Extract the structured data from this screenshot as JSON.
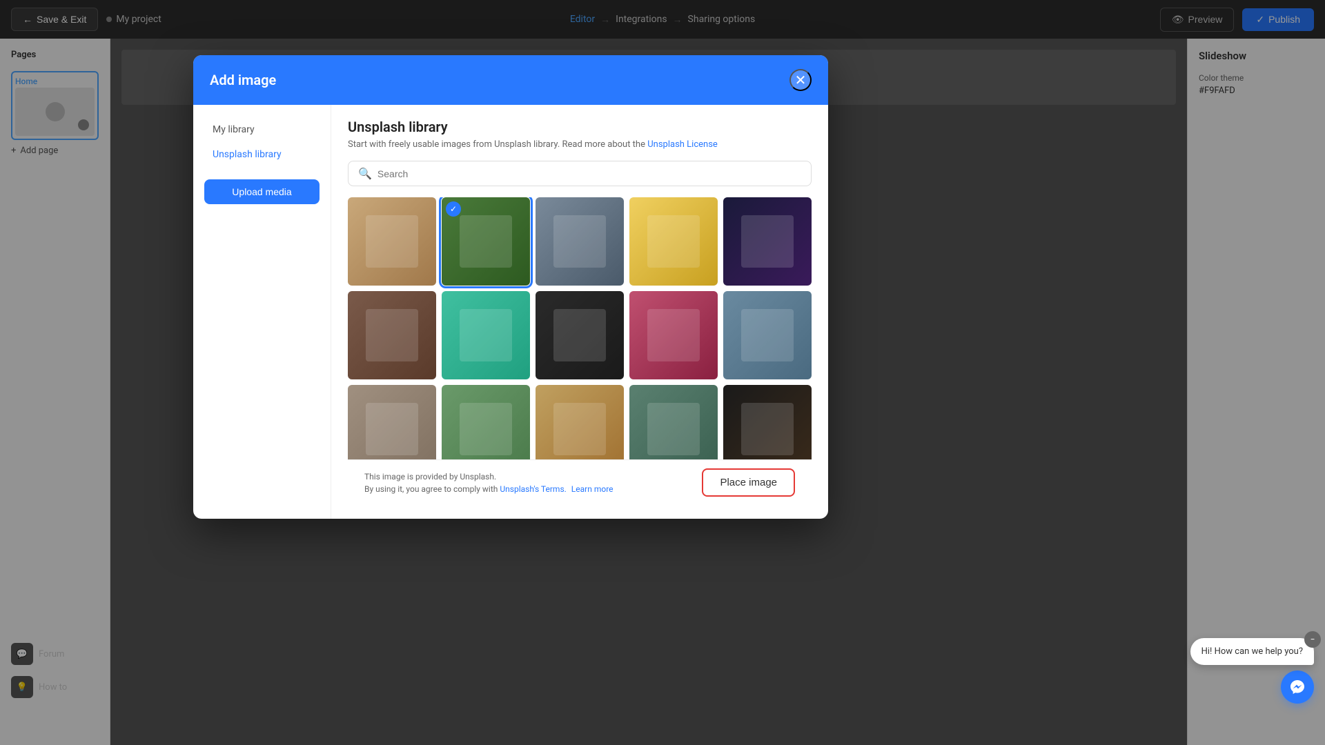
{
  "topNav": {
    "saveExit": "Save & Exit",
    "projectName": "My project",
    "steps": [
      {
        "label": "Editor",
        "active": true
      },
      {
        "label": "Integrations",
        "active": false
      },
      {
        "label": "Sharing options",
        "active": false
      }
    ],
    "preview": "Preview",
    "publish": "Publish"
  },
  "leftSidebar": {
    "title": "Pages",
    "pages": [
      {
        "label": "Home",
        "selected": true
      }
    ],
    "addPage": "Add page",
    "bottomItems": [
      {
        "label": "Forum",
        "icon": "💬"
      },
      {
        "label": "How to",
        "icon": "💡"
      }
    ]
  },
  "rightSidebar": {
    "title": "Slideshow",
    "colorThemeLabel": "Color theme",
    "colorThemeValue": "#F9FAFD"
  },
  "modal": {
    "title": "Add image",
    "closeLabel": "×",
    "sidebar": {
      "items": [
        {
          "label": "My library",
          "active": false
        },
        {
          "label": "Unsplash library",
          "active": true
        }
      ],
      "uploadBtn": "Upload media"
    },
    "content": {
      "title": "Unsplash library",
      "description": "Start with freely usable images from Unsplash library. Read more about the",
      "linkText": "Unsplash License",
      "search": {
        "placeholder": "Search",
        "value": ""
      },
      "images": [
        {
          "id": 1,
          "selected": false,
          "class": "img-1"
        },
        {
          "id": 2,
          "selected": true,
          "class": "img-2"
        },
        {
          "id": 3,
          "selected": false,
          "class": "img-3"
        },
        {
          "id": 4,
          "selected": false,
          "class": "img-4"
        },
        {
          "id": 5,
          "selected": false,
          "class": "img-5"
        },
        {
          "id": 6,
          "selected": false,
          "class": "img-6"
        },
        {
          "id": 7,
          "selected": false,
          "class": "img-7"
        },
        {
          "id": 8,
          "selected": false,
          "class": "img-8"
        },
        {
          "id": 9,
          "selected": false,
          "class": "img-9"
        },
        {
          "id": 10,
          "selected": false,
          "class": "img-10"
        },
        {
          "id": 11,
          "selected": false,
          "class": "img-11"
        },
        {
          "id": 12,
          "selected": false,
          "class": "img-12"
        },
        {
          "id": 13,
          "selected": false,
          "class": "img-13"
        },
        {
          "id": 14,
          "selected": false,
          "class": "img-14"
        },
        {
          "id": 15,
          "selected": false,
          "class": "img-15"
        }
      ]
    },
    "footer": {
      "line1": "This image is provided by Unsplash.",
      "line2": "By using it, you agree to comply with",
      "link1": "Unsplash's Terms.",
      "link2": "Learn more",
      "placeBtn": "Place image"
    }
  },
  "chat": {
    "bubbleText": "Hi! How can we help you?",
    "closeBtnLabel": "−",
    "avatarIcon": "f"
  },
  "icons": {
    "arrowLeft": "←",
    "arrowRight": "→",
    "checkmark": "✓",
    "eye": "👁",
    "plus": "+",
    "search": "🔍",
    "close": "✕",
    "messenger": "m"
  }
}
